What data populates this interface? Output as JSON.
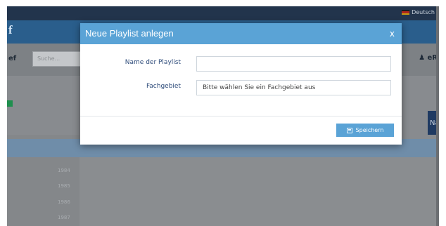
{
  "app": {
    "language": "Deutsch",
    "brand_fragment": "f",
    "toolbar_fragment": "ef",
    "search_placeholder": "Suche...",
    "user_fragment": "eR",
    "side_button_fragment": "Na",
    "list_numbers": [
      "1984",
      "1985",
      "1986",
      "1987"
    ]
  },
  "modal": {
    "title": "Neue Playlist anlegen",
    "close_label": "x",
    "name_label": "Name der Playlist",
    "name_value": "",
    "subject_label": "Fachgebiet",
    "subject_selected": "Bitte wählen Sie ein Fachgebiet aus",
    "save_label": "Speichern"
  },
  "icons": {
    "lang": "german-flag-icon",
    "user": "user-icon",
    "save": "floppy-disk-icon"
  },
  "colors": {
    "accent": "#5aa3d6",
    "label_text": "#2c4a79",
    "topbar": "#22344c"
  }
}
